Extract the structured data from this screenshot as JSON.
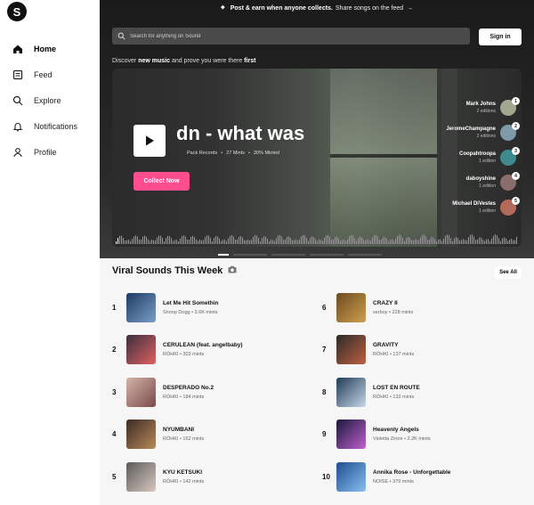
{
  "logo": {
    "letter": "S"
  },
  "nav": [
    {
      "label": "Home",
      "icon": "home-icon"
    },
    {
      "label": "Feed",
      "icon": "feed-icon"
    },
    {
      "label": "Explore",
      "icon": "search-icon"
    },
    {
      "label": "Notifications",
      "icon": "bell-icon"
    },
    {
      "label": "Profile",
      "icon": "person-icon"
    }
  ],
  "banner": {
    "lead": "Post & earn when anyone collects.",
    "tail": "Share songs on the feed",
    "arrow": "→"
  },
  "search": {
    "placeholder": "Search for anything on Sound"
  },
  "signin": "Sign in",
  "discover": {
    "pre": "Discover",
    "bold1": "new music",
    "mid": "and prove you were there",
    "bold2": "first"
  },
  "hero": {
    "title": "dn - what was",
    "artist": "Pack Records",
    "mints": "27 Mints",
    "minted": "30% Minted",
    "collect": "Collect Now",
    "collectors": [
      {
        "name": "Mark Johns",
        "editions": "2 editions",
        "rank": "1",
        "color": "#a0a88f"
      },
      {
        "name": "JeromeChampagne",
        "editions": "2 editions",
        "rank": "2",
        "color": "#7e9aa6"
      },
      {
        "name": "Coopahtroopa",
        "editions": "1 edition",
        "rank": "3",
        "color": "#3e8a8e"
      },
      {
        "name": "daboyshine",
        "editions": "1 edition",
        "rank": "4",
        "color": "#8a6d6d"
      },
      {
        "name": "Michael DiVestes",
        "editions": "1 edition",
        "rank": "5",
        "color": "#b46a5a"
      }
    ]
  },
  "viral": {
    "title": "Viral Sounds This Week",
    "see_all": "See All",
    "tracks": [
      {
        "n": "1",
        "title": "Let Me Hit Somethin",
        "sub": "Snoop Dogg • 3.6K mints",
        "c1": "#1d3a63",
        "c2": "#7aa0c8"
      },
      {
        "n": "2",
        "title": "CERULEAN (feat. angelbaby)",
        "sub": "RŌHKI • 303 mints",
        "c1": "#3a2f3f",
        "c2": "#e06060"
      },
      {
        "n": "3",
        "title": "DESPERADO No.2",
        "sub": "RŌHKI • 184 mints",
        "c1": "#d2b3a8",
        "c2": "#7a4a4a"
      },
      {
        "n": "4",
        "title": "NYUMBANI",
        "sub": "RŌHKI • 152 mints",
        "c1": "#3c2a22",
        "c2": "#b88a5a"
      },
      {
        "n": "5",
        "title": "KYU KETSUKI",
        "sub": "RŌHKI • 142 mints",
        "c1": "#5a5a5a",
        "c2": "#d8c8c0"
      },
      {
        "n": "6",
        "title": "CRAZY II",
        "sub": "serboy • 228 mints",
        "c1": "#6b4a1e",
        "c2": "#d0a050"
      },
      {
        "n": "7",
        "title": "GRAVITY",
        "sub": "RŌHKI • 137 mints",
        "c1": "#2a2a2a",
        "c2": "#c06040"
      },
      {
        "n": "8",
        "title": "LOST EN ROUTE",
        "sub": "RŌHKI • 132 mints",
        "c1": "#1f3b55",
        "c2": "#c8d8e8"
      },
      {
        "n": "9",
        "title": "Heavenly Angels",
        "sub": "Violetta Zironi • 2.2K mints",
        "c1": "#181838",
        "c2": "#c060d0"
      },
      {
        "n": "10",
        "title": "Annika Rose - Unforgettable",
        "sub": "NOISE • 379 mints",
        "c1": "#1f4d8f",
        "c2": "#88c0f0"
      }
    ]
  }
}
